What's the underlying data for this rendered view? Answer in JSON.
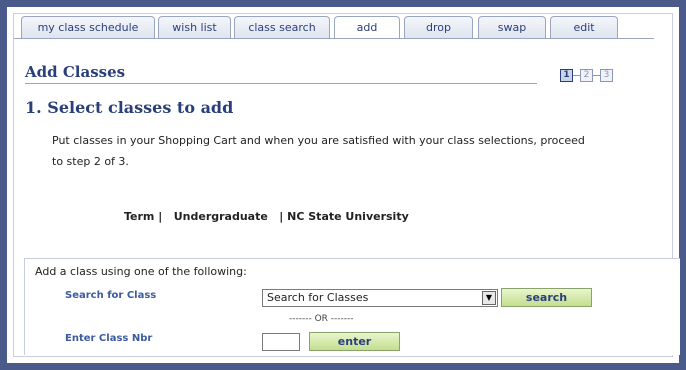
{
  "tabs": [
    {
      "label": "my class schedule",
      "active": false
    },
    {
      "label": "wish list",
      "active": false
    },
    {
      "label": "class search",
      "active": false
    },
    {
      "label": "add",
      "active": true
    },
    {
      "label": "drop",
      "active": false
    },
    {
      "label": "swap",
      "active": false
    },
    {
      "label": "edit",
      "active": false
    }
  ],
  "page": {
    "title": "Add Classes",
    "steps": [
      "1",
      "2",
      "3"
    ],
    "current_step": 1,
    "section_title": "1.  Select classes to add",
    "instructions": "Put classes in your Shopping Cart and when you are satisfied with your class selections, proceed to step 2 of 3."
  },
  "term": {
    "text": "Term |   Undergraduate   | NC State University"
  },
  "add_class": {
    "intro": "Add a class using one of the following:",
    "search_label": "Search for Class",
    "search_select_value": "Search for Classes",
    "search_button": "search",
    "or_separator": "------- OR -------",
    "class_nbr_label": "Enter Class Nbr",
    "class_nbr_value": "",
    "enter_button": "enter"
  },
  "colors": {
    "frame": "#4a5a8a",
    "heading": "#2a3f7a",
    "label_link": "#3b5aa0",
    "button_green": "#c3de8e"
  }
}
